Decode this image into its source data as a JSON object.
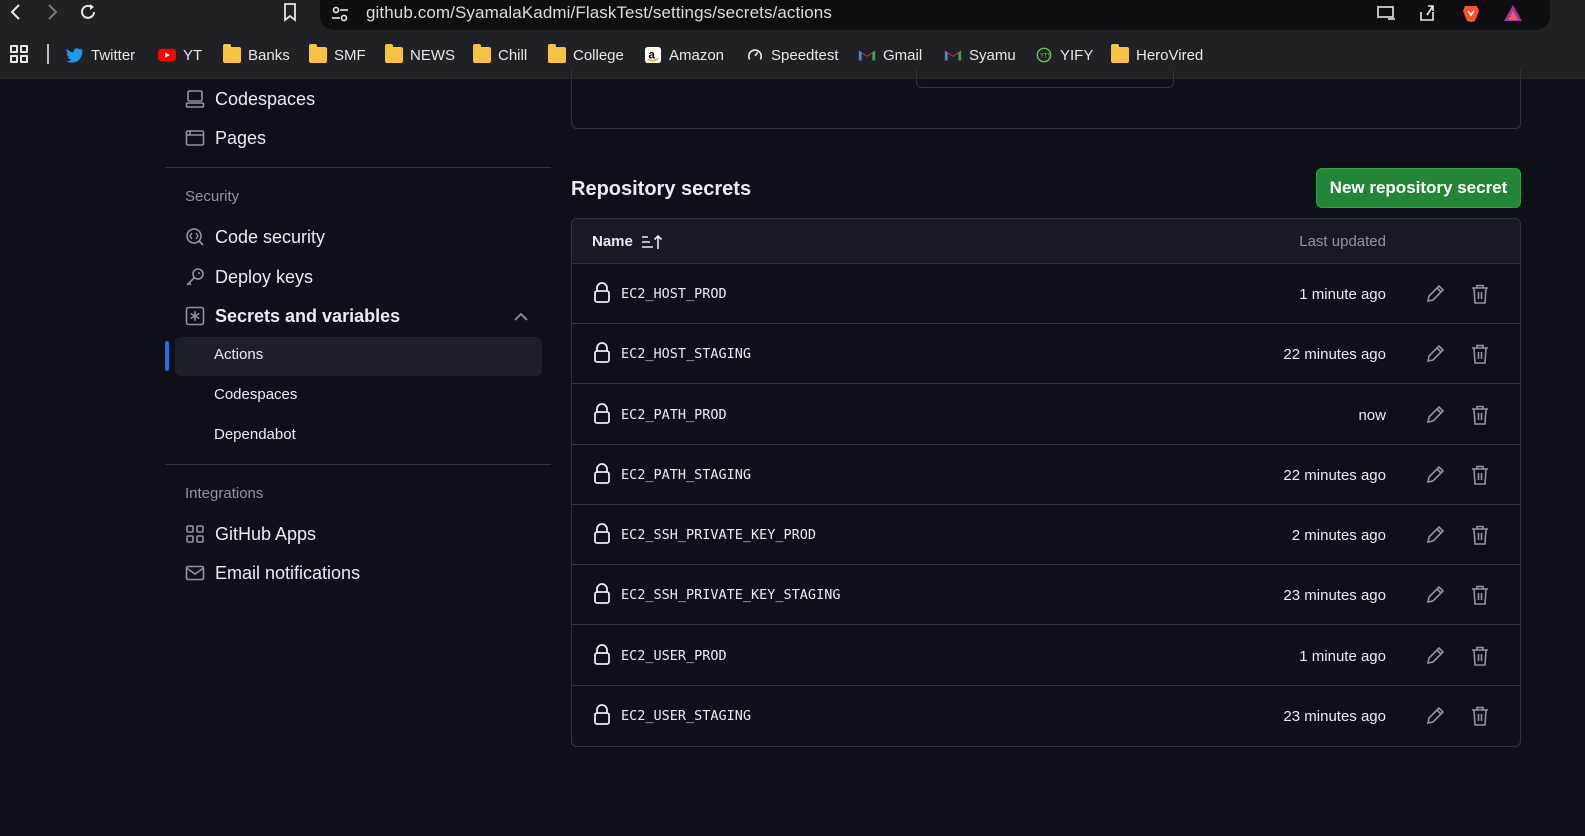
{
  "browser": {
    "url": "github.com/SyamalaKadmi/FlaskTest/settings/secrets/actions",
    "bookmarks": [
      {
        "label": "Twitter",
        "icon": "twitter-icon"
      },
      {
        "label": "YT",
        "icon": "youtube-icon"
      },
      {
        "label": "Banks",
        "icon": "folder-icon"
      },
      {
        "label": "SMF",
        "icon": "folder-icon"
      },
      {
        "label": "NEWS",
        "icon": "folder-icon"
      },
      {
        "label": "Chill",
        "icon": "folder-icon"
      },
      {
        "label": "College",
        "icon": "folder-icon"
      },
      {
        "label": "Amazon",
        "icon": "amazon-icon"
      },
      {
        "label": "Speedtest",
        "icon": "speedtest-icon"
      },
      {
        "label": "Gmail",
        "icon": "gmail-icon"
      },
      {
        "label": "Syamu",
        "icon": "gmail-icon"
      },
      {
        "label": "YIFY",
        "icon": "yify-icon"
      },
      {
        "label": "HeroVired",
        "icon": "folder-icon"
      }
    ]
  },
  "sidebar": {
    "top_items": [
      {
        "label": "Codespaces",
        "icon": "codespaces-icon"
      },
      {
        "label": "Pages",
        "icon": "pages-icon"
      }
    ],
    "security_heading": "Security",
    "security_items": [
      {
        "label": "Code security",
        "icon": "code-security-icon"
      },
      {
        "label": "Deploy keys",
        "icon": "key-icon"
      },
      {
        "label": "Secrets and variables",
        "icon": "asterisk-icon"
      }
    ],
    "sub_items": [
      "Actions",
      "Codespaces",
      "Dependabot"
    ],
    "integrations_heading": "Integrations",
    "integration_items": [
      {
        "label": "GitHub Apps",
        "icon": "apps-icon"
      },
      {
        "label": "Email notifications",
        "icon": "mail-icon"
      }
    ]
  },
  "main": {
    "section_title": "Repository secrets",
    "new_button": "New repository secret",
    "columns": {
      "name": "Name",
      "updated": "Last updated"
    },
    "secrets": [
      {
        "name": "EC2_HOST_PROD",
        "updated": "1 minute ago"
      },
      {
        "name": "EC2_HOST_STAGING",
        "updated": "22 minutes ago"
      },
      {
        "name": "EC2_PATH_PROD",
        "updated": "now"
      },
      {
        "name": "EC2_PATH_STAGING",
        "updated": "22 minutes ago"
      },
      {
        "name": "EC2_SSH_PRIVATE_KEY_PROD",
        "updated": "2 minutes ago"
      },
      {
        "name": "EC2_SSH_PRIVATE_KEY_STAGING",
        "updated": "23 minutes ago"
      },
      {
        "name": "EC2_USER_PROD",
        "updated": "1 minute ago"
      },
      {
        "name": "EC2_USER_STAGING",
        "updated": "23 minutes ago"
      }
    ]
  },
  "colors": {
    "accent": "#1f6feb",
    "button": "#238636",
    "background": "#0d1117"
  }
}
